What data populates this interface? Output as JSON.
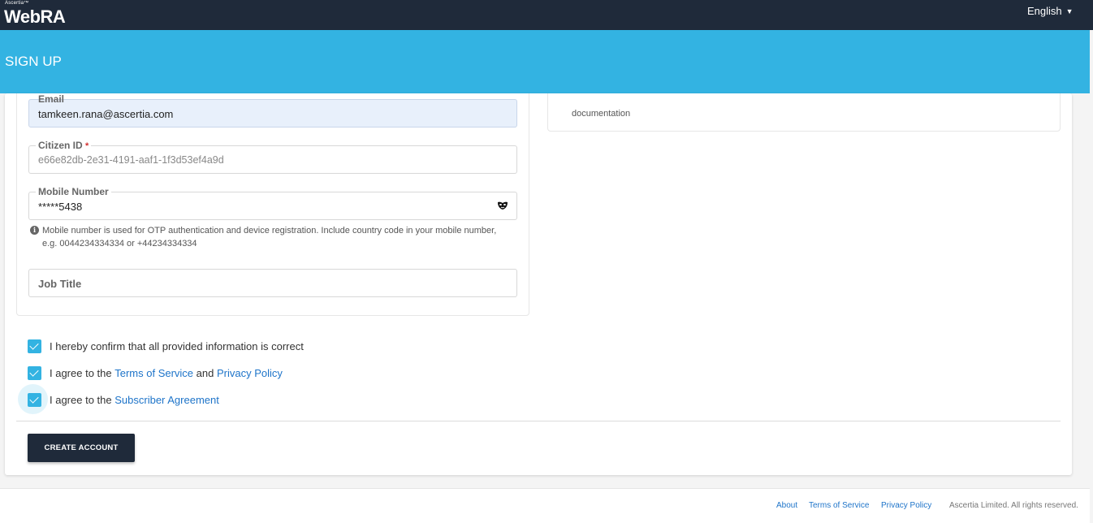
{
  "header": {
    "brand_small": "Ascertia™",
    "brand_name": "WebRA",
    "language": "English"
  },
  "banner": {
    "title": "SIGN UP"
  },
  "form": {
    "email": {
      "label": "Email",
      "value": "tamkeen.rana@ascertia.com"
    },
    "citizen_id": {
      "label": "Citizen ID",
      "required_mark": "*",
      "value": "e66e82db-2e31-4191-aaf1-1f3d53ef4a9d"
    },
    "mobile": {
      "label": "Mobile Number",
      "value": "*****5438",
      "hint": "Mobile number is used for OTP authentication and device registration. Include country code in your mobile number, e.g. 0044234334334 or +44234334334",
      "toggle_icon": "mask-icon"
    },
    "job_title": {
      "label": "Job Title",
      "value": ""
    }
  },
  "right_panel": {
    "text": "documentation"
  },
  "checks": {
    "confirm": {
      "text": "I hereby confirm that all provided information is correct",
      "checked": true
    },
    "terms": {
      "prefix": "I agree to the ",
      "link1": "Terms of Service",
      "middle": " and ",
      "link2": "Privacy Policy",
      "checked": true
    },
    "subscriber": {
      "prefix": "I agree to the ",
      "link": "Subscriber Agreement",
      "checked": true
    }
  },
  "actions": {
    "create_label": "CREATE ACCOUNT"
  },
  "footer": {
    "about": "About",
    "terms": "Terms of Service",
    "privacy": "Privacy Policy",
    "copyright": "Ascertia Limited. All rights reserved."
  },
  "colors": {
    "header": "#1f2a3a",
    "banner": "#33b3e2",
    "link": "#1e74c9",
    "checkbox": "#33b3e2"
  }
}
